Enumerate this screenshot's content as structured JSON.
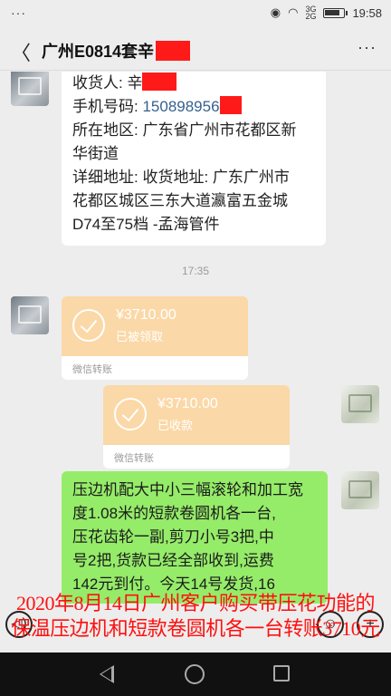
{
  "status_bar": {
    "menu_dots": "···",
    "signal_top": "3G",
    "signal_bottom": "2G",
    "time": "19:58",
    "battery_level": 0.85
  },
  "header": {
    "back_glyph": "〈",
    "title": "广州E0814套辛",
    "more_glyph": "···"
  },
  "address_message": {
    "recipient_label": "收货人: 辛",
    "phone_label": "手机号码: ",
    "phone_value": "150898956",
    "region_label": "所在地区: 广东省广州市花都区新",
    "region_line2": "华街道",
    "detail_line1": "详细地址: 收货地址:  广东广州市",
    "detail_line2": "花都区城区三东大道瀛富五金城",
    "detail_line3": "D74至75档 -孟海管件"
  },
  "timestamp": "17:35",
  "transfers": [
    {
      "amount": "¥3710.00",
      "status": "已被领取",
      "footer": "微信转账"
    },
    {
      "amount": "¥3710.00",
      "status": "已收款",
      "footer": "微信转账"
    }
  ],
  "order_message": {
    "lines": [
      "压边机配大中小三幅滚轮和加工宽",
      "度1.08米的短款卷圆机各一台,",
      "压花齿轮一副,剪刀小号3把,中",
      "号2把,货款已经全部收到,运费",
      "142元到付。今天14号发货,16"
    ]
  },
  "overlay_caption": {
    "line1": "2020年8月14日广州客户购买带压花功能的",
    "line2": "保温压边机和短款卷圆机各一台转账3710元"
  },
  "input_icons": {
    "voice": "◁)",
    "emoji": "☺",
    "plus": "+"
  }
}
